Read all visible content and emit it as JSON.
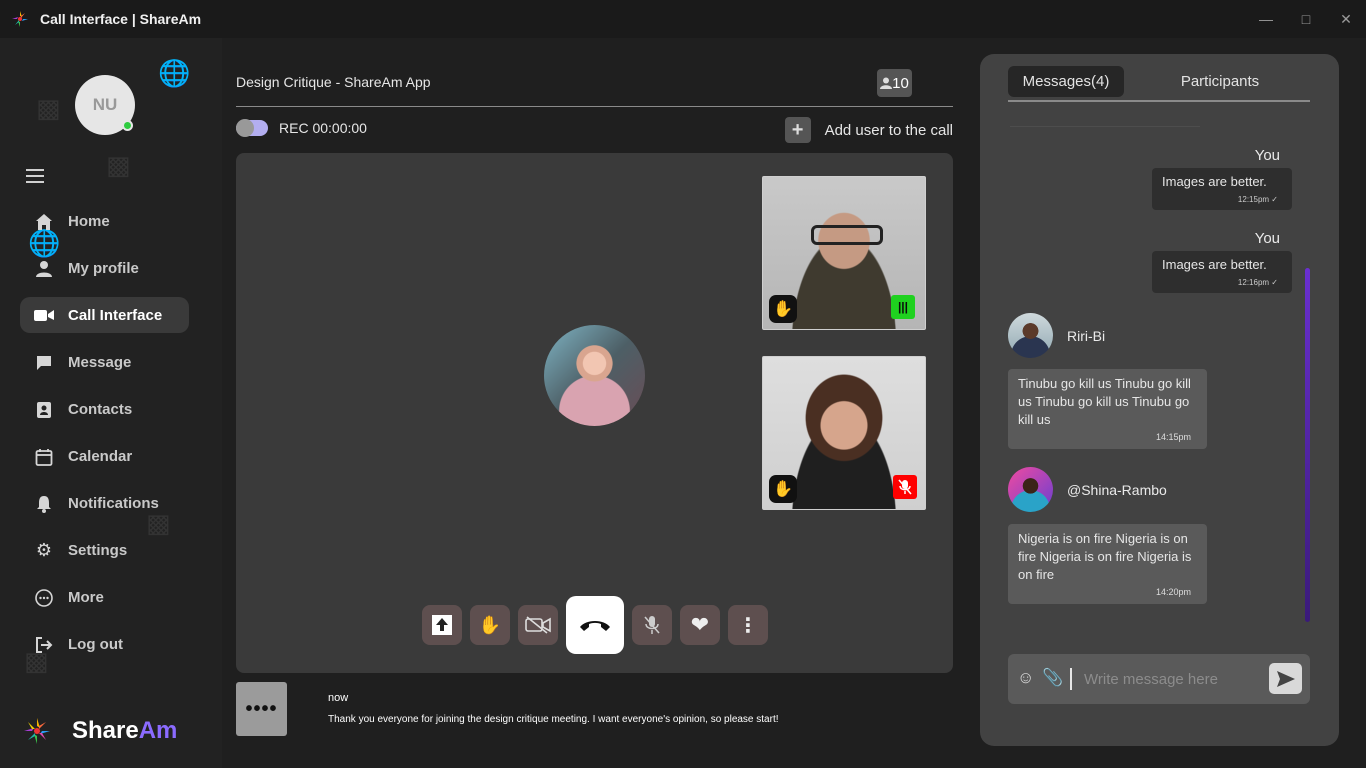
{
  "window": {
    "title": "Call Interface | ShareAm",
    "minimize_icon": "minimize-icon",
    "maximize_icon": "maximize-icon",
    "close_icon": "close-icon"
  },
  "sidebar": {
    "avatar_initials": "NU",
    "online_status_color": "#2ecc40",
    "items": [
      {
        "label": "Home",
        "icon": "home-icon"
      },
      {
        "label": "My profile",
        "icon": "user-icon"
      },
      {
        "label": "Call Interface",
        "icon": "video-camera-icon",
        "active": true
      },
      {
        "label": "Message",
        "icon": "chat-bubble-icon"
      },
      {
        "label": "Contacts",
        "icon": "contact-card-icon"
      },
      {
        "label": "Calendar",
        "icon": "calendar-icon"
      },
      {
        "label": "Notifications",
        "icon": "bell-icon"
      },
      {
        "label": "Settings",
        "icon": "gear-icon"
      },
      {
        "label": "More",
        "icon": "more-circle-icon"
      },
      {
        "label": "Log out",
        "icon": "logout-icon"
      }
    ],
    "brand": {
      "part1": "Share",
      "part2": "Am",
      "accent": "#8b6bff"
    }
  },
  "call": {
    "meeting_title": "Design Critique - ShareAm App",
    "participant_count": "10",
    "recording_label": "REC 00:00:00",
    "add_user_label": "Add user to the call"
  },
  "notification": {
    "thumb": "••••",
    "time": "now",
    "message": "Thank you everyone for joining the design critique meeting. I want everyone's opinion, so please start!"
  },
  "chat": {
    "tabs": {
      "messages": "Messages(4)",
      "participants": "Participants"
    },
    "messages": [
      {
        "sender": "You",
        "text": "Images are better.",
        "time": "12:15pm"
      },
      {
        "sender": "You",
        "text": "Images are better.",
        "time": "12:16pm"
      },
      {
        "sender": "Riri-Bi",
        "text": "Tinubu go kill us Tinubu go kill us Tinubu go kill us Tinubu go kill us",
        "time": "14:15pm"
      },
      {
        "sender": "@Shina-Rambo",
        "text": "Nigeria is on fire Nigeria is on fire Nigeria is on fire Nigeria is on fire",
        "time": "14:20pm"
      }
    ],
    "composer": {
      "placeholder": "Write message here"
    }
  }
}
